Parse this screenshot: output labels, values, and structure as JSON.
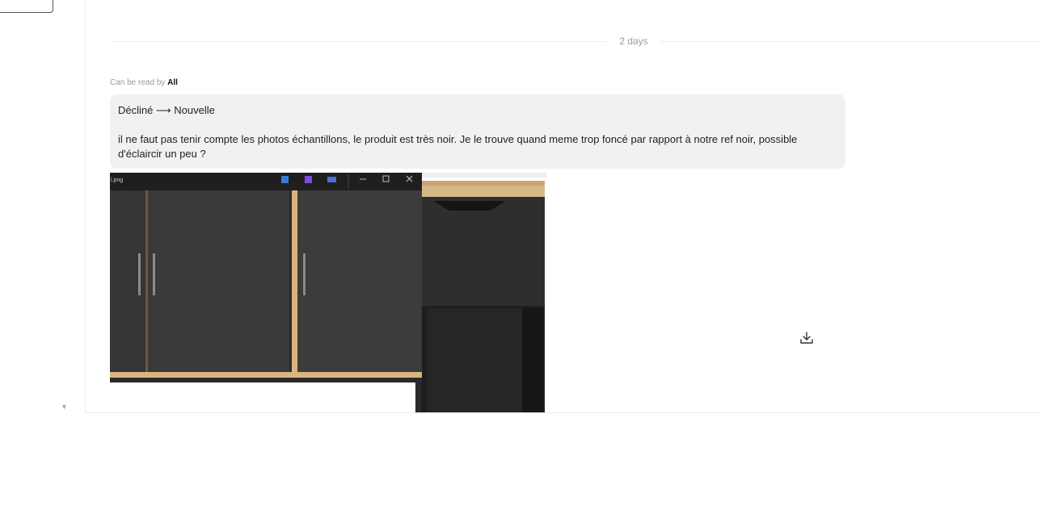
{
  "divider": {
    "label": "2 days"
  },
  "message": {
    "visibility_prefix": "Can be read by",
    "visibility_value": "All",
    "status_from": "Décliné",
    "status_arrow": "⟶",
    "status_to": "Nouvelle",
    "body": "il ne faut pas tenir compte les photos échantillons, le produit est très noir. Je le trouve quand meme trop foncé par rapport à notre ref noir, possible d'éclaircir un peu ?"
  },
  "attachment": {
    "window_title": "i.png",
    "icons": [
      "photos-app-icon",
      "video-app-icon",
      "onedrive-icon"
    ],
    "window_controls": [
      "minimize-icon",
      "maximize-icon",
      "close-icon"
    ]
  },
  "actions": {
    "download_icon": "download-icon"
  }
}
